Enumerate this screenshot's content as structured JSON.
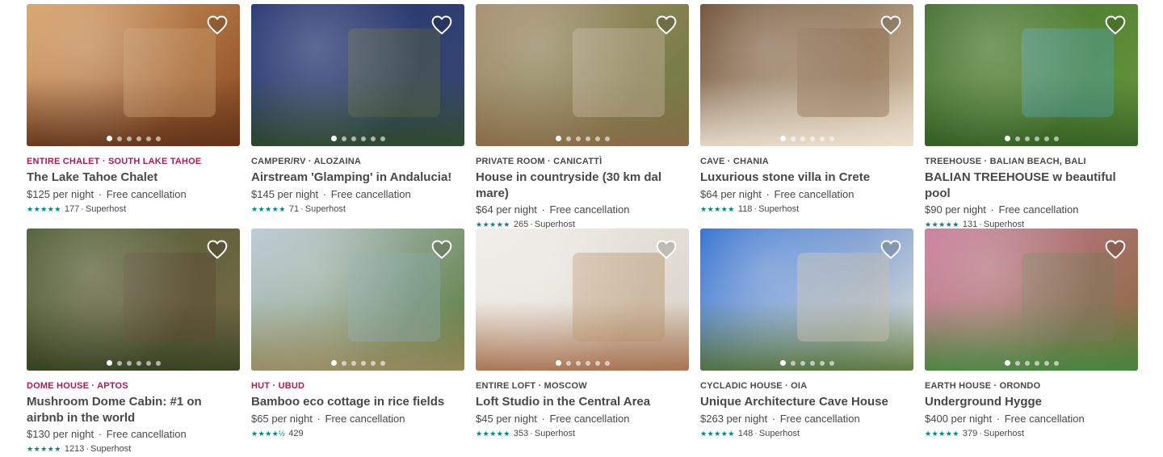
{
  "listings": [
    {
      "kind": "ENTIRE CHALET · SOUTH LAKE TAHOE",
      "kind_color": "#a61d55",
      "title": "The Lake Tahoe Chalet",
      "price": "$125",
      "per_night": "per night",
      "cancellation": "Free cancellation",
      "stars": "★★★★★",
      "rating": 5,
      "review_count": "177",
      "superhost": "Superhost",
      "photo_colors": [
        "#d7a065",
        "#8a4a22",
        "#5b3018",
        "#c79a6a"
      ],
      "photo_count": 6,
      "active_photo": 0
    },
    {
      "kind": "CAMPER/RV · ALOZAINA",
      "kind_color": "#484848",
      "title": "Airstream 'Glamping' in Andalucia!",
      "price": "$145",
      "per_night": "per night",
      "cancellation": "Free cancellation",
      "stars": "★★★★★",
      "rating": 5,
      "review_count": "71",
      "superhost": "Superhost",
      "photo_colors": [
        "#1e2f6e",
        "#3b4a73",
        "#2f4a24",
        "#5a6340"
      ],
      "photo_count": 6,
      "active_photo": 0
    },
    {
      "kind": "PRIVATE ROOM · CANICATTÌ",
      "kind_color": "#484848",
      "title": "House in countryside (30 km dal mare)",
      "price": "$64",
      "per_night": "per night",
      "cancellation": "Free cancellation",
      "stars": "★★★★★",
      "rating": 5,
      "review_count": "265",
      "superhost": "Superhost",
      "photo_colors": [
        "#a48a6a",
        "#6d7a3e",
        "#8a6a4a",
        "#c2b29a"
      ],
      "photo_count": 6,
      "active_photo": 0
    },
    {
      "kind": "CAVE · CHANIA",
      "kind_color": "#484848",
      "title": "Luxurious stone villa in Crete",
      "price": "$64",
      "per_night": "per night",
      "cancellation": "Free cancellation",
      "stars": "★★★★★",
      "rating": 5,
      "review_count": "118",
      "superhost": "Superhost",
      "photo_colors": [
        "#6a4a2e",
        "#d6c4a8",
        "#efe6d8",
        "#8a6a4e"
      ],
      "photo_count": 6,
      "active_photo": 0
    },
    {
      "kind": "TREEHOUSE · BALIAN BEACH, BALI",
      "kind_color": "#484848",
      "title": "BALIAN TREEHOUSE w beautiful pool",
      "price": "$90",
      "per_night": "per night",
      "cancellation": "Free cancellation",
      "stars": "★★★★★",
      "rating": 5,
      "review_count": "131",
      "superhost": "Superhost",
      "photo_colors": [
        "#3e6a2a",
        "#6a9a3e",
        "#2f5a22",
        "#4fa0a8"
      ],
      "photo_count": 6,
      "active_photo": 0
    },
    {
      "kind": "DOME HOUSE · APTOS",
      "kind_color": "#a61d55",
      "title": "Mushroom Dome Cabin: #1 on airbnb in the world",
      "price": "$130",
      "per_night": "per night",
      "cancellation": "Free cancellation",
      "stars": "★★★★★",
      "rating": 5,
      "review_count": "1213",
      "superhost": "Superhost",
      "photo_colors": [
        "#4a5a2e",
        "#7a6a4a",
        "#2f3e1e",
        "#5a4a32"
      ],
      "photo_count": 6,
      "active_photo": 0
    },
    {
      "kind": "HUT · UBUD",
      "kind_color": "#a61d55",
      "title": "Bamboo eco cottage in rice fields",
      "price": "$65",
      "per_night": "per night",
      "cancellation": "Free cancellation",
      "stars": "★★★★½",
      "rating": 4.5,
      "review_count": "429",
      "superhost": "",
      "photo_colors": [
        "#b8c8d4",
        "#5a7a3a",
        "#9a8a5e",
        "#8aa8a8"
      ],
      "photo_count": 6,
      "active_photo": 0
    },
    {
      "kind": "ENTIRE LOFT · MOSCOW",
      "kind_color": "#484848",
      "title": "Loft Studio in the Central Area",
      "price": "$45",
      "per_night": "per night",
      "cancellation": "Free cancellation",
      "stars": "★★★★★",
      "rating": 5,
      "review_count": "353",
      "superhost": "Superhost",
      "photo_colors": [
        "#f0ede8",
        "#d8d2c8",
        "#a0643e",
        "#b8926a"
      ],
      "photo_count": 6,
      "active_photo": 0
    },
    {
      "kind": "CYCLADIC HOUSE · OIA",
      "kind_color": "#484848",
      "title": "Unique Architecture Cave House",
      "price": "$263",
      "per_night": "per night",
      "cancellation": "Free cancellation",
      "stars": "★★★★★",
      "rating": 5,
      "review_count": "148",
      "superhost": "Superhost",
      "photo_colors": [
        "#2a6ad0",
        "#e8e4da",
        "#4a6a2a",
        "#c8c0b0"
      ],
      "photo_count": 6,
      "active_photo": 0
    },
    {
      "kind": "EARTH HOUSE · ORONDO",
      "kind_color": "#484848",
      "title": "Underground Hygge",
      "price": "$400",
      "per_night": "per night",
      "cancellation": "Free cancellation",
      "stars": "★★★★★",
      "rating": 5,
      "review_count": "379",
      "superhost": "Superhost",
      "photo_colors": [
        "#c87a9a",
        "#8a6a3e",
        "#3e8a3e",
        "#7a7a5a"
      ],
      "photo_count": 6,
      "active_photo": 0
    }
  ]
}
